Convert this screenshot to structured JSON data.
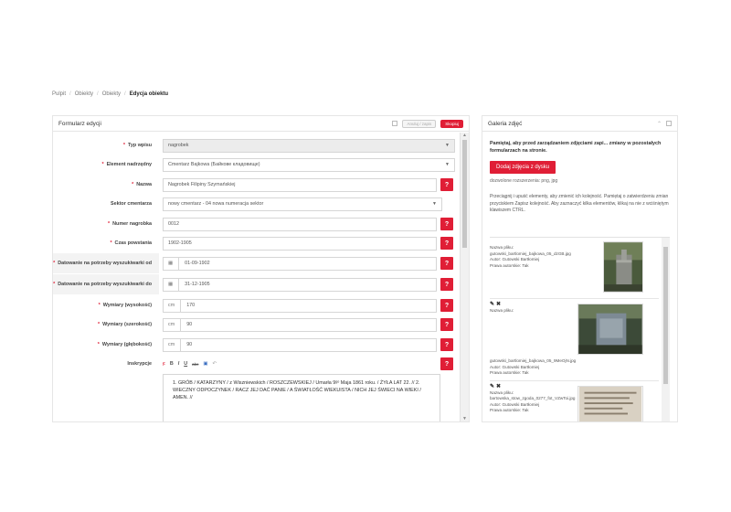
{
  "breadcrumb": [
    "Pulpit",
    "Obiekty",
    "Obiekty",
    "Edycja obiektu"
  ],
  "form": {
    "title": "Formularz edycji",
    "btn_grey": "Anuluj / zapis",
    "btn_copy": "Skopiuj",
    "help_label": "?",
    "fields": [
      {
        "label": "Typ wpisu",
        "required": true,
        "value": "nagrobek",
        "type": "select-grey"
      },
      {
        "label": "Element nadrzędny",
        "required": true,
        "value": "Cmentarz Bajkowa (Байкове кладовище)",
        "type": "select"
      },
      {
        "label": "Nazwa",
        "required": true,
        "value": "Nagrobek Filipiny Szymańskiej",
        "type": "text"
      },
      {
        "label": "Sektor cmentarza",
        "required": false,
        "value": "nowy cmentarz - 04 nowa numeracja sektor",
        "type": "select"
      },
      {
        "label": "Numer nagrobka",
        "required": true,
        "value": "0012",
        "type": "text"
      },
      {
        "label": "Czas powstania",
        "required": true,
        "value": "1902-1905",
        "type": "text"
      },
      {
        "label": "Datowanie na potrzeby wyszukiwarki od",
        "required": true,
        "value": "01-09-1902",
        "type": "date"
      },
      {
        "label": "Datowanie na potrzeby wyszukiwarki do",
        "required": true,
        "value": "31-12-1905",
        "type": "date"
      },
      {
        "label": "Wymiary (wysokość)",
        "required": true,
        "value": "170",
        "unit": "cm",
        "type": "unit"
      },
      {
        "label": "Wymiary (szerokość)",
        "required": true,
        "value": "90",
        "unit": "cm",
        "type": "unit"
      },
      {
        "label": "Wymiary (głębokość)",
        "required": true,
        "value": "90",
        "unit": "cm",
        "type": "unit"
      }
    ],
    "inscription_label": "Inskrypcje",
    "inscription_text": "1. GRÓB / KATARZYNY / z Wiszniewskich / ROSZCZEWSKIEJ / Umarła 9ᵍᵒ Maja 1861 roku. / ŻYŁA LAT 22. // 2. WIECZNY ODPOCZYNEK / RACZ JEJ DAĆ PANIE / A ŚWIATŁOŚĆ WIEKUISTA / NICH JEJ ŚWIECI NA WIEKI / AMEN. //",
    "toolbar": [
      "B",
      "I",
      "U",
      "abc"
    ]
  },
  "gallery": {
    "title": "Galeria zdjęć",
    "warning": "Pamiętaj, aby przed zarządzaniem zdjęciami zapi... zmiany w pozostałych formularzach na stronie.",
    "add_button": "Dodaj zdjęcia z dysku",
    "extensions": "dozwolone rozszerzenia: png, jpg",
    "hint": "Przeciągnij i upuść elementy, aby zmienić ich kolejność. Pamiętaj o zatwierdzeniu zmian przyciskiem Zapisz kolejność. Aby zaznaczyć kilka elementów, klikaj na nie z wciśniętym klawiszem CTRL.",
    "items": [
      {
        "line1": "Nazwa pliku:",
        "line2": "gutowski_bartlomiej_bajkowa_05_dzGB.jpg",
        "line3": "Autor: Gutowski Bartłomiej",
        "line4": "Prawa autorskie: Tak"
      },
      {
        "line1": "Nazwa pliku:",
        "line2": "gutowski_bartlomiej_bajkowa_05_9MeOjN.jpg",
        "line3": "Autor: Gutowski Bartłomiej",
        "line4": "Prawa autorskie: Tak"
      },
      {
        "line1": "Nazwa pliku:",
        "line2": "bartowska_stow_zgoda_0277_fot_VZwToi.jpg",
        "line3": "Autor: Gutowski Bartłomiej",
        "line4": "Prawa autorskie: Tak"
      }
    ]
  }
}
